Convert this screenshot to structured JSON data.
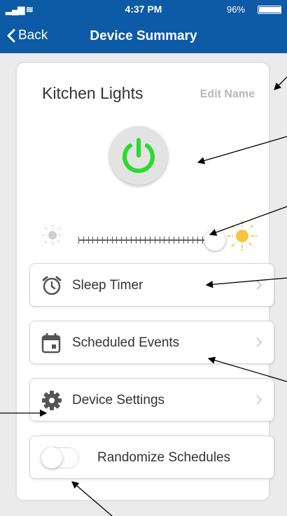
{
  "status_bar": {
    "time": "4:37 PM",
    "battery": "96%",
    "battery_level": 0.96
  },
  "nav": {
    "back_label": "Back",
    "title": "Device Summary"
  },
  "device": {
    "name": "Kitchen Lights",
    "edit_label": "Edit Name",
    "power_on": true
  },
  "brightness": {
    "level": 1.0
  },
  "menu": [
    {
      "label": "Sleep Timer",
      "icon": "alarm-clock-icon"
    },
    {
      "label": "Scheduled Events",
      "icon": "calendar-icon"
    },
    {
      "label": "Device Settings",
      "icon": "gear-icon"
    }
  ],
  "randomize": {
    "label": "Randomize Schedules",
    "enabled": false
  },
  "colors": {
    "brand_blue": "#0d5aa6",
    "power_green": "#2bdb2b",
    "sun_yellow": "#f5c542"
  }
}
